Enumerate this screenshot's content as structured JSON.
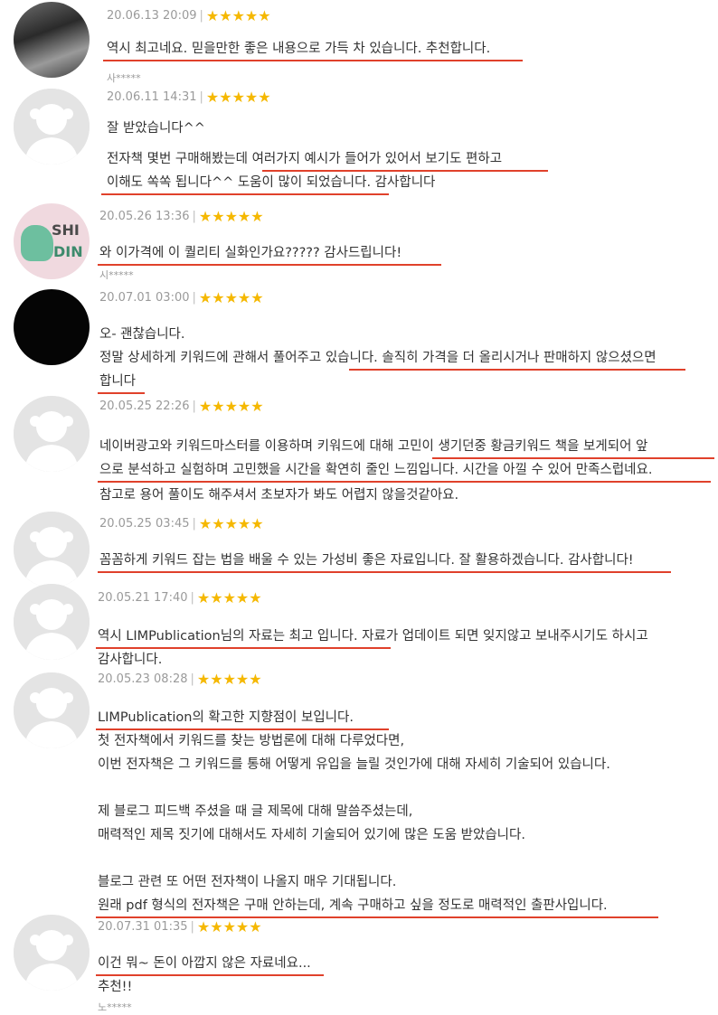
{
  "reviews": [
    {
      "date": "20.06.13 20:09",
      "sep": "|",
      "stars": "★★★★★",
      "avatar": "photo-avatar",
      "lines": [
        "역시 최고네요. 믿을만한 좋은 내용으로 가득 차 있습니다. 추천합니다."
      ],
      "author": "사*****"
    },
    {
      "date": "20.06.11 14:31",
      "sep": "|",
      "stars": "★★★★★",
      "avatar": "default-avatar",
      "lines": [
        "잘 받았습니다^^",
        "전자책 몇번 구매해봤는데 여러가지 예시가 들어가 있어서 보기도 편하고",
        "이해도 쏙쏙 됩니다^^ 도움이 많이 되었습니다. 감사합니다"
      ]
    },
    {
      "date": "20.05.26 13:36",
      "sep": "|",
      "stars": "★★★★★",
      "avatar": "dino-avatar",
      "avatar_text1": "SHI",
      "avatar_text2": "DIN",
      "lines": [
        "와 이가격에 이 퀄리티 실화인가요????? 감사드립니다!"
      ],
      "author": "시*****"
    },
    {
      "date": "20.07.01 03:00",
      "sep": "|",
      "stars": "★★★★★",
      "avatar": "black-avatar",
      "lines": [
        "오- 괜찮습니다.",
        "정말 상세하게 키워드에 관해서 풀어주고 있습니다. 솔직히 가격을 더 올리시거나 판매하지 않으셨으면",
        "합니다"
      ]
    },
    {
      "date": "20.05.25 22:26",
      "sep": "|",
      "stars": "★★★★★",
      "avatar": "default-avatar",
      "lines": [
        "네이버광고와 키워드마스터를 이용하며 키워드에 대해 고민이 생기던중 황금키워드 책을 보게되어 앞",
        "으로 분석하고 실험하며 고민했을 시간을 확연히 줄인 느낌입니다. 시간을 아낄 수 있어 만족스럽네요.",
        "참고로 용어 풀이도 해주셔서 초보자가 봐도 어렵지 않을것같아요."
      ]
    },
    {
      "date": "20.05.25 03:45",
      "sep": "|",
      "stars": "★★★★★",
      "avatar": "default-avatar",
      "lines": [
        "꼼꼼하게 키워드 잡는 법을 배울 수 있는 가성비 좋은 자료입니다. 잘 활용하겠습니다. 감사합니다!"
      ]
    },
    {
      "date": "20.05.21 17:40",
      "sep": "|",
      "stars": "★★★★★",
      "avatar": "default-avatar",
      "lines": [
        "역시 LIMPublication님의 자료는 최고 입니다. 자료가 업데이트 되면 잊지않고 보내주시기도 하시고",
        "감사합니다."
      ]
    },
    {
      "date": "20.05.23 08:28",
      "sep": "|",
      "stars": "★★★★★",
      "avatar": "default-avatar",
      "lines": [
        "LIMPublication의 확고한 지향점이 보입니다.",
        "첫 전자책에서 키워드를 찾는 방법론에 대해 다루었다면,",
        "이번 전자책은 그 키워드를 통해 어떻게 유입을 늘릴 것인가에 대해 자세히 기술되어 있습니다.",
        "",
        "제 블로그 피드백 주셨을 때 글 제목에 대해 말씀주셨는데,",
        "매력적인 제목 짓기에 대해서도 자세히 기술되어 있기에 많은 도움 받았습니다.",
        "",
        "블로그 관련 또 어떤 전자책이 나올지 매우 기대됩니다.",
        "원래 pdf 형식의 전자책은 구매 안하는데, 계속 구매하고 싶을 정도로 매력적인 출판사입니다."
      ]
    },
    {
      "date": "20.07.31 01:35",
      "sep": "|",
      "stars": "★★★★★",
      "avatar": "default-avatar",
      "lines": [
        "이건 뭐~ 돈이 아깝지 않은 자료네요...",
        "추천!!"
      ],
      "author": "노*****"
    }
  ],
  "colors": {
    "underline": "#e0412b",
    "star": "#f5b800",
    "meta": "#9a9a9a",
    "text": "#333333"
  }
}
